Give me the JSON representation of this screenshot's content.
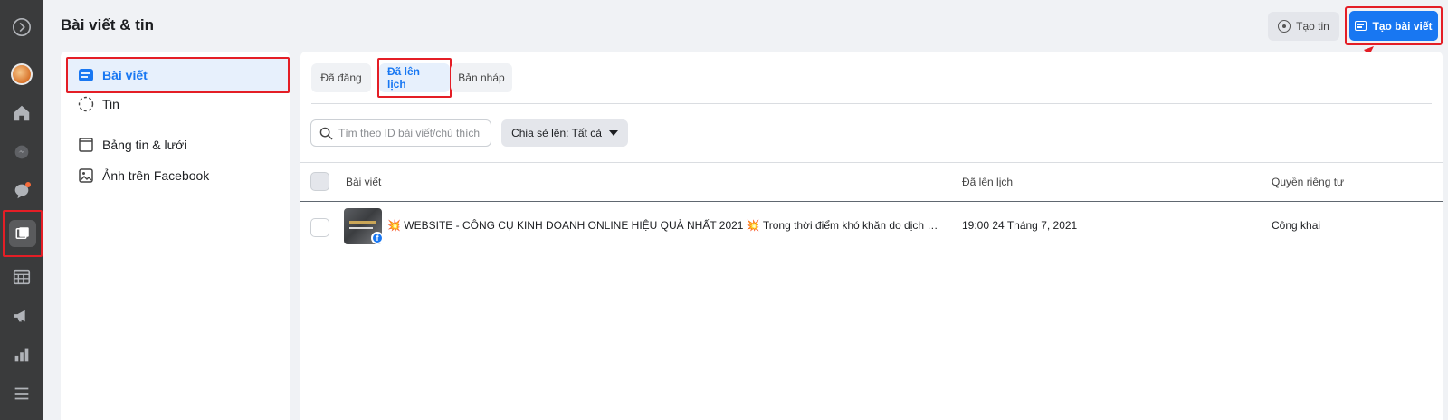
{
  "header": {
    "title": "Bài viết & tin",
    "create_story_label": "Tạo tin",
    "create_post_label": "Tạo bài viết"
  },
  "rail": {
    "icons": [
      "logo-icon",
      "avatar",
      "home-icon",
      "messenger-icon",
      "comment-icon",
      "posts-icon",
      "calendar-icon",
      "megaphone-icon",
      "insights-icon",
      "menu-icon"
    ]
  },
  "sidebar": {
    "items": [
      {
        "label": "Bài viết",
        "icon": "post-icon",
        "active": true
      },
      {
        "label": "Tin",
        "icon": "story-icon",
        "active": false
      },
      {
        "label": "Bảng tin & lưới",
        "icon": "feed-grid-icon",
        "active": false
      },
      {
        "label": "Ảnh trên Facebook",
        "icon": "photo-icon",
        "active": false
      }
    ]
  },
  "main": {
    "tabs": [
      {
        "label": "Đã đăng",
        "active": false
      },
      {
        "label": "Đã lên lịch",
        "active": true
      },
      {
        "label": "Bản nháp",
        "active": false
      }
    ],
    "search": {
      "placeholder": "Tìm theo ID bài viết/chú thích"
    },
    "filter": {
      "label": "Chia sẻ lên: Tất cả"
    },
    "table": {
      "columns": [
        "Bài viết",
        "Đã lên lịch",
        "Quyền riêng tư"
      ],
      "rows": [
        {
          "post": "WEBSITE - CÔNG CỤ KINH DOANH ONLINE HIỆU QUẢ NHẤT 2021 💥 Trong thời điểm khó khăn do dịch bệnh bùng ...",
          "emoji": "💥",
          "scheduled": "19:00 24 Tháng 7, 2021",
          "privacy": "Công khai"
        }
      ]
    }
  },
  "colors": {
    "accent": "#1877f2",
    "highlight_border": "#e41e26",
    "rail_bg": "#3a3b3c"
  }
}
